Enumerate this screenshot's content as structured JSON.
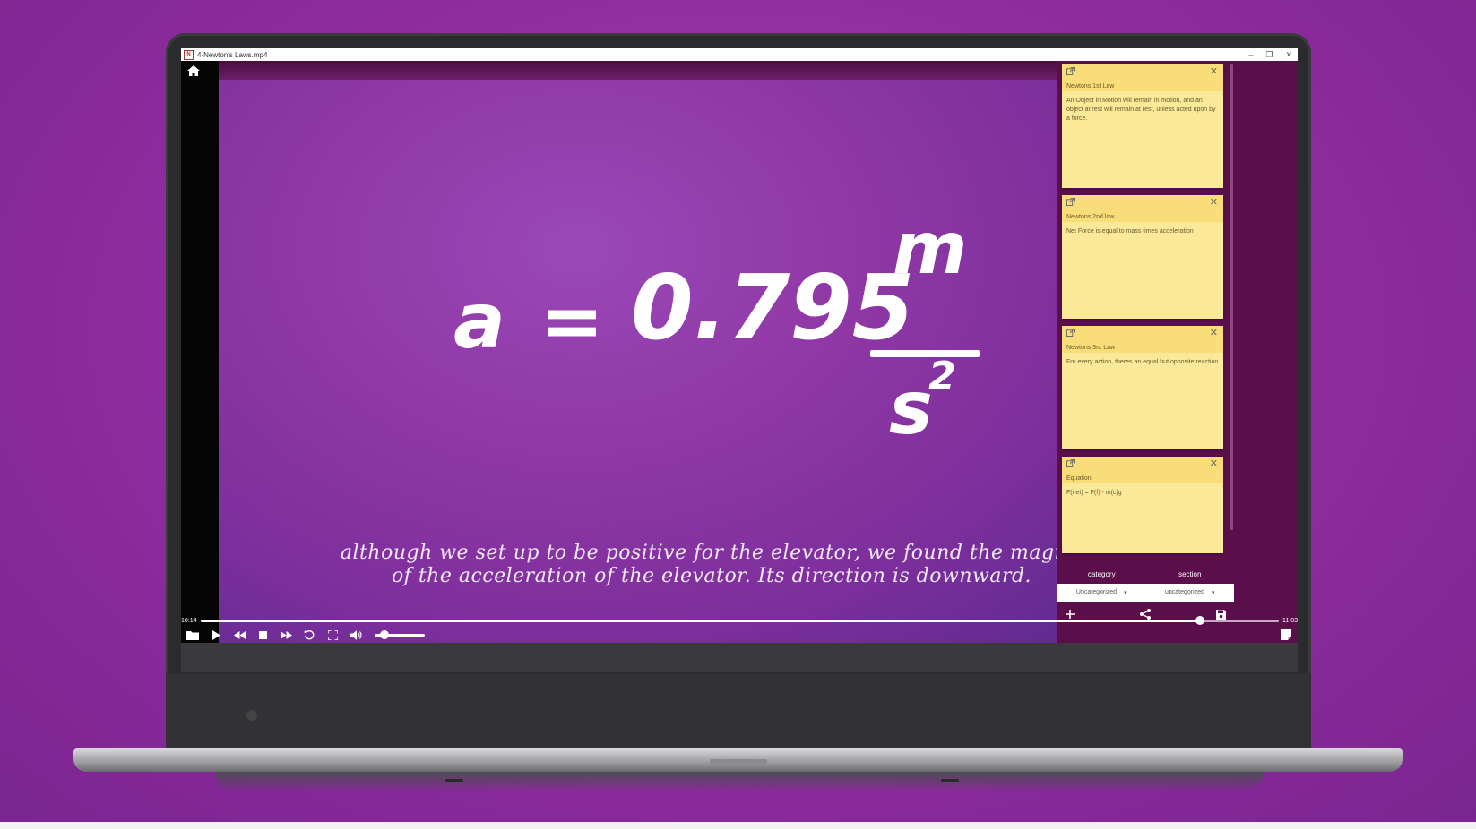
{
  "window": {
    "title": "4-Newton's Laws.mp4",
    "app_icon_letter": "N",
    "controls": {
      "minimize": "–",
      "restore": "❐",
      "close": "✕"
    }
  },
  "video": {
    "equation": {
      "var": "a",
      "eq": "=",
      "value": "0.795",
      "numerator": "m",
      "denominator": "s",
      "exponent": "2"
    },
    "caption": {
      "line1": "although we set up to be positive for the elevator, we found the magnit",
      "line2": "of the acceleration of the elevator. Its direction is downward."
    }
  },
  "notes": [
    {
      "title": "Newtons 1st Law",
      "body": "An Object in Motion will remain in motion, and an object at rest will remain at rest, unless acted upon by a force."
    },
    {
      "title": "Newtons 2nd law",
      "body": "Net Force is equal to mass times acceleration"
    },
    {
      "title": "Newtons 3rd Law",
      "body": "For every action, theres an equal but opposite reaction"
    },
    {
      "title": "Equation",
      "body": "F(net) = F(f) - m(c)g"
    }
  ],
  "panel": {
    "category_label": "category",
    "section_label": "section",
    "category_value": "Uncategorized",
    "section_value": "uncategorized"
  },
  "player": {
    "current_time": "10:14",
    "total_time": "11:03",
    "progress": 0.927,
    "volume": 0.2
  },
  "colors": {
    "accent": "#9a48b8",
    "note": "#fbe99a",
    "note_header": "#f9dd78",
    "bg": "#8e2c9e"
  }
}
